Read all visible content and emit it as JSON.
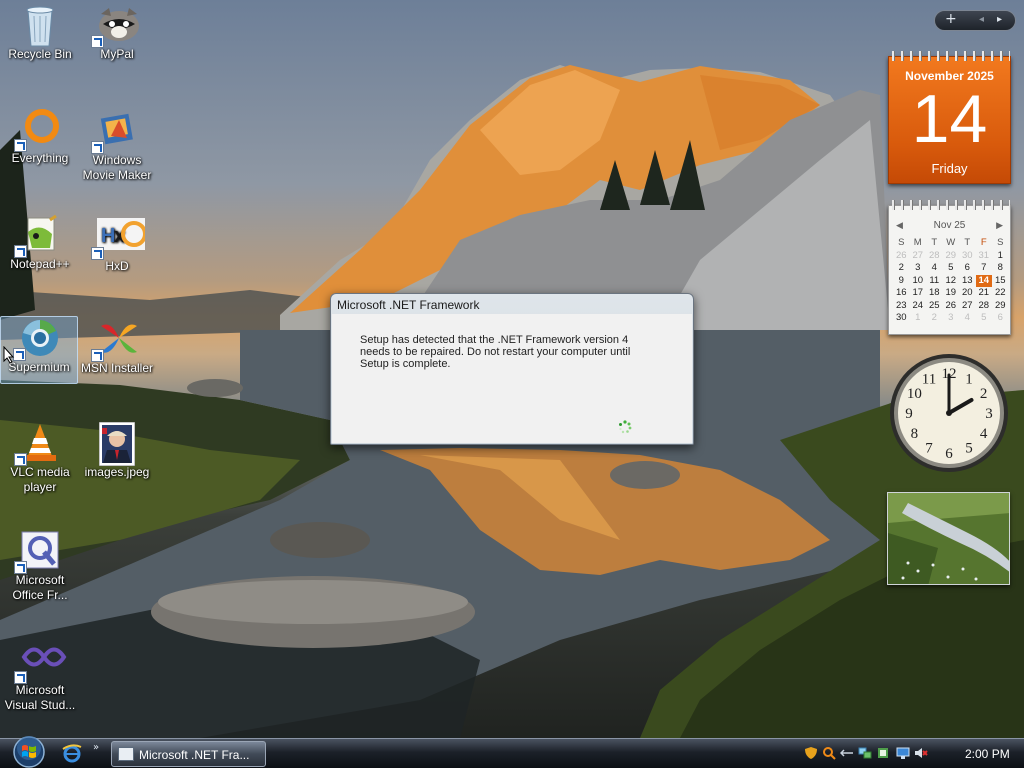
{
  "desktop_icons": [
    {
      "label": "Recycle Bin",
      "icon": "recycle-bin-icon"
    },
    {
      "label": "MyPal",
      "icon": "mypal-icon"
    },
    {
      "label": "Everything",
      "icon": "everything-icon"
    },
    {
      "label": "Windows Movie Maker",
      "icon": "movie-maker-icon"
    },
    {
      "label": "Notepad++",
      "icon": "notepad-plus-plus-icon"
    },
    {
      "label": "HxD",
      "icon": "hxd-icon"
    },
    {
      "label": "Supermium",
      "icon": "supermium-icon"
    },
    {
      "label": "MSN Installer",
      "icon": "msn-installer-icon"
    },
    {
      "label": "VLC media player",
      "icon": "vlc-icon"
    },
    {
      "label": "images.jpeg",
      "icon": "image-file-icon"
    },
    {
      "label": "Microsoft Office Fr...",
      "icon": "office-icon"
    },
    {
      "label": "Microsoft Visual Stud...",
      "icon": "visual-studio-icon"
    }
  ],
  "gadgets": {
    "toolbar": {
      "add": "+",
      "prev": "◂",
      "next": "▸"
    },
    "calendar_big": {
      "month_year": "November 2025",
      "day": "14",
      "weekday": "Friday"
    },
    "calendar_small": {
      "header": "Nov 25",
      "weekdays": [
        "S",
        "M",
        "T",
        "W",
        "T",
        "F",
        "S"
      ],
      "weeks": [
        [
          "26",
          "27",
          "28",
          "29",
          "30",
          "31",
          "1"
        ],
        [
          "2",
          "3",
          "4",
          "5",
          "6",
          "7",
          "8"
        ],
        [
          "9",
          "10",
          "11",
          "12",
          "13",
          "14",
          "15"
        ],
        [
          "16",
          "17",
          "18",
          "19",
          "20",
          "21",
          "22"
        ],
        [
          "23",
          "24",
          "25",
          "26",
          "27",
          "28",
          "29"
        ],
        [
          "30",
          "1",
          "2",
          "3",
          "4",
          "5",
          "6"
        ]
      ],
      "today": "14"
    },
    "clock": {
      "numerals": [
        "12",
        "1",
        "2",
        "3",
        "4",
        "5",
        "6",
        "7",
        "8",
        "9",
        "10",
        "11"
      ],
      "hour": 2,
      "minute": 0
    }
  },
  "dialog": {
    "title": "Microsoft .NET Framework",
    "message": "Setup has detected that the .NET Framework version 4 needs to be repaired. Do not restart your computer until Setup is complete."
  },
  "taskbar": {
    "task_label": "Microsoft .NET Fra...",
    "quick_launch_more": "»",
    "time": "2:00 PM"
  },
  "colors": {
    "calendar_accent": "#e06a14",
    "taskbar": "#1c2129"
  }
}
